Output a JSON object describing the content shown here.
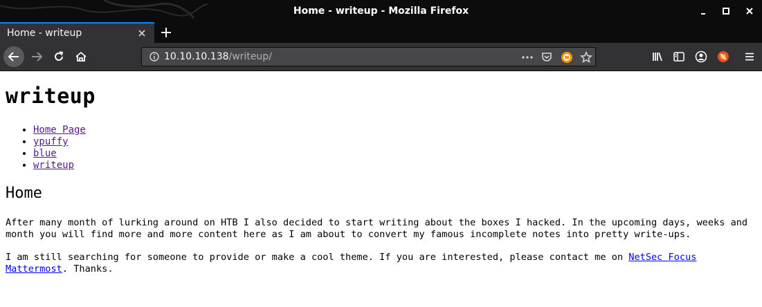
{
  "window": {
    "title": "Home - writeup - Mozilla Firefox"
  },
  "tabs": [
    {
      "label": "Home - writeup",
      "active": true
    }
  ],
  "urlbar": {
    "host": "10.10.10.138",
    "path": "/writeup/"
  },
  "icons": {
    "back": "back-arrow-icon",
    "forward": "forward-arrow-icon",
    "reload": "reload-icon",
    "home": "home-icon",
    "info": "info-icon",
    "page_actions": "more-dots-icon",
    "pocket": "pocket-icon",
    "extension": "extension-icon",
    "bookmark": "star-icon",
    "library": "library-icon",
    "sidebar": "sidebar-icon",
    "account": "account-icon",
    "addon": "addon-icon",
    "menu": "hamburger-menu-icon"
  },
  "colors": {
    "chrome_dark": "#0c0c0d",
    "toolbar": "#323234",
    "urlbar": "#474749",
    "tab_accent": "#0a84ff",
    "visited_link": "#551a8b",
    "link": "#0000ee"
  },
  "page": {
    "site_title": "writeup",
    "nav": [
      {
        "label": "Home Page"
      },
      {
        "label": "ypuffy"
      },
      {
        "label": "blue"
      },
      {
        "label": "writeup"
      }
    ],
    "heading": "Home",
    "paragraph1": "After many month of lurking around on HTB I also decided to start writing about the boxes I hacked. In the upcoming days, weeks and month you will find more and more content here as I am about to convert my famous incomplete notes into pretty write-ups.",
    "paragraph2_before": "I am still searching for someone to provide or make a cool theme. If you are interested, please contact me on ",
    "paragraph2_link": "NetSec Focus Mattermost",
    "paragraph2_after": ". Thanks."
  }
}
